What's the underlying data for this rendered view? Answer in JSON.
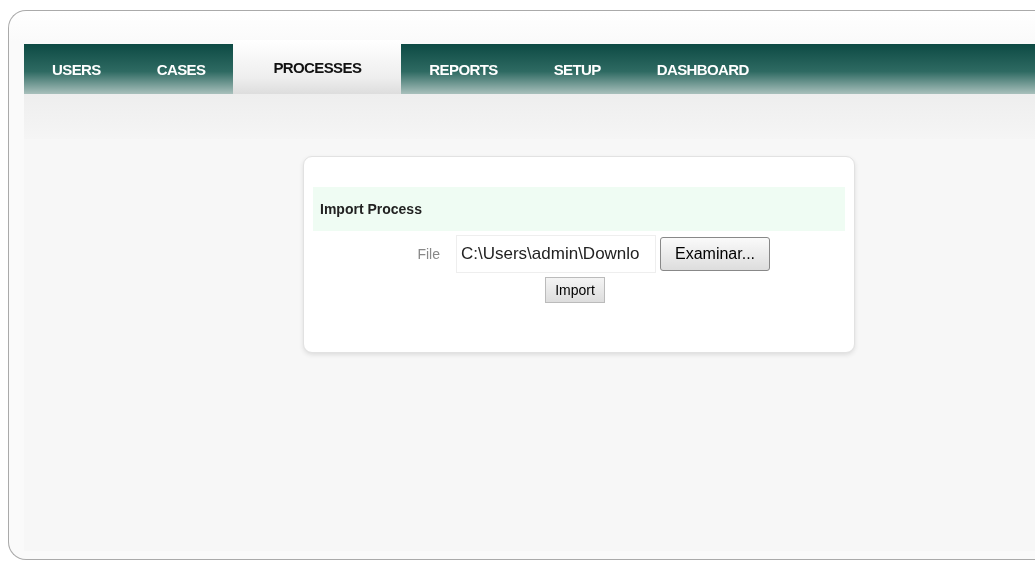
{
  "tabs": [
    {
      "label": "USERS",
      "selected": false
    },
    {
      "label": "CASES",
      "selected": false
    },
    {
      "label": "PROCESSES",
      "selected": true
    },
    {
      "label": "REPORTS",
      "selected": false
    },
    {
      "label": "SETUP",
      "selected": false
    },
    {
      "label": "DASHBOARD",
      "selected": false
    }
  ],
  "import_panel": {
    "title": "Import Process",
    "file_label": "File",
    "file_value": "C:\\Users\\admin\\Downlo",
    "browse_button": "Examinar...",
    "import_button": "Import"
  }
}
